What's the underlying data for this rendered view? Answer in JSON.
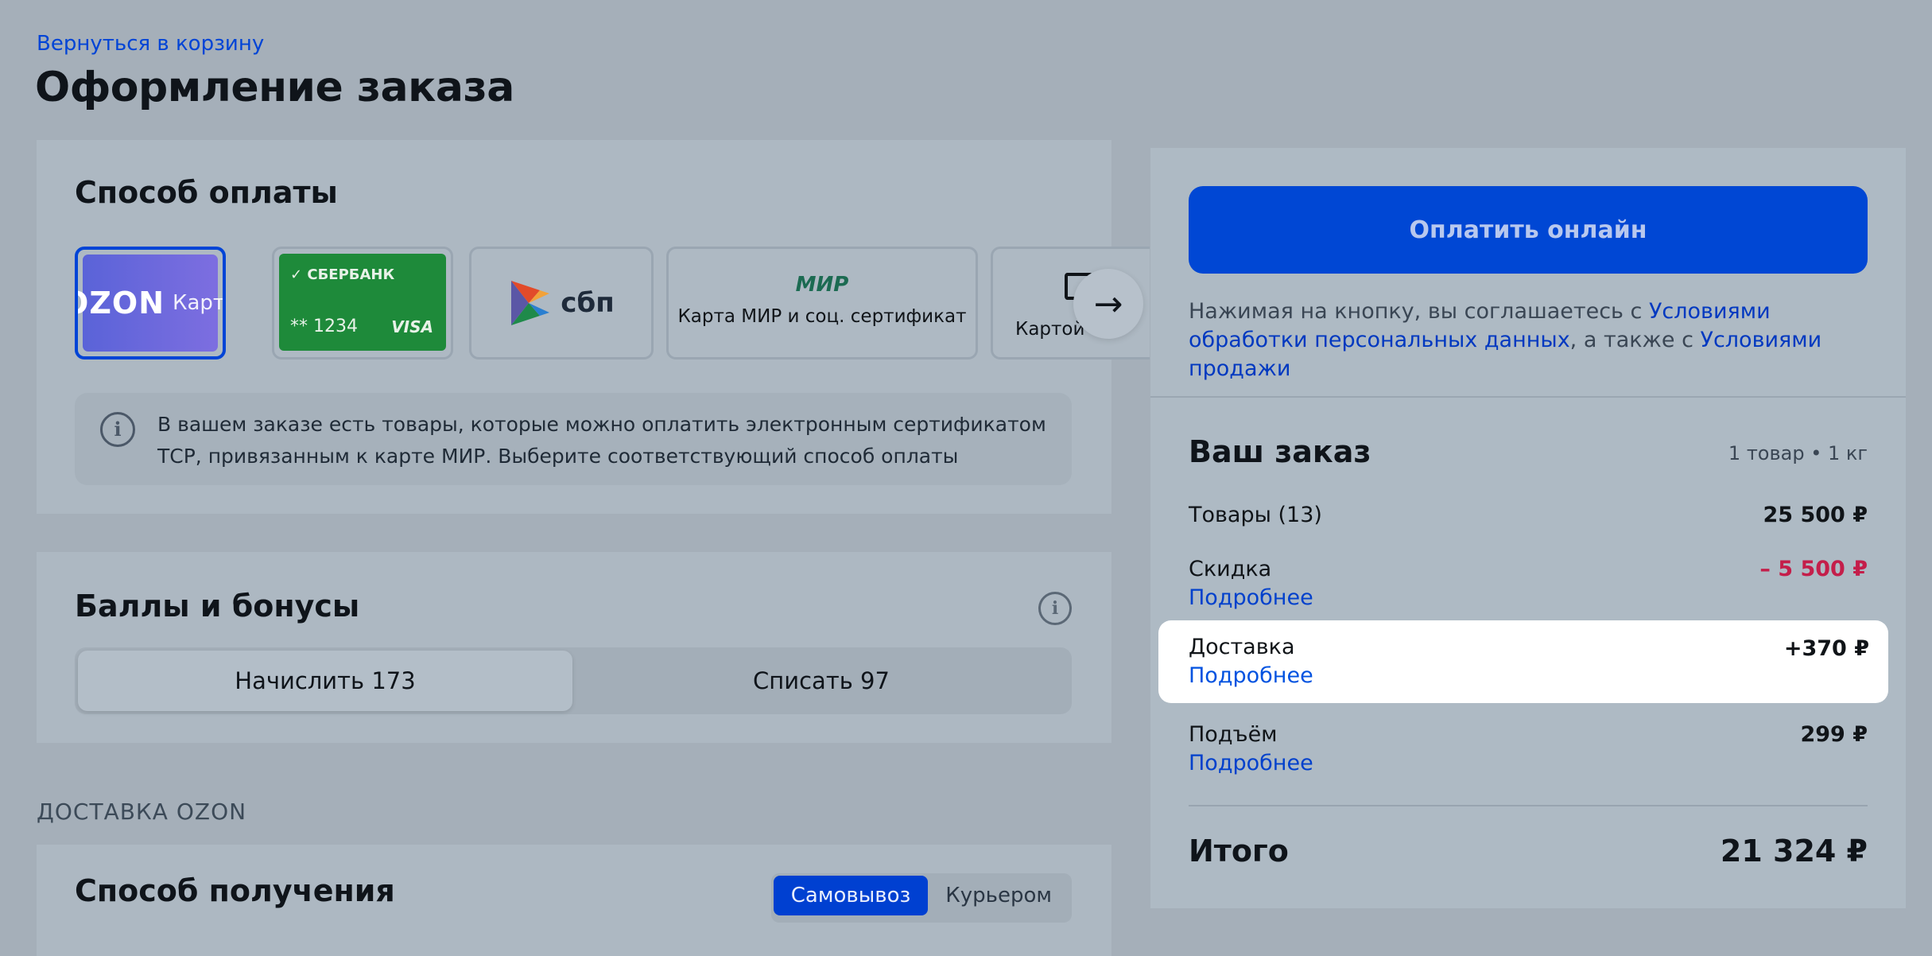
{
  "header": {
    "back_link": "Вернуться в корзину",
    "title": "Оформление заказа"
  },
  "payment": {
    "title": "Способ оплаты",
    "cards": {
      "ozon": {
        "logo": "OZON",
        "sub": "Карта"
      },
      "sber": {
        "name": "СБЕРБАНК",
        "number": "** 1234",
        "network": "VISA"
      },
      "sbp": {
        "label": "сбп"
      },
      "mir": {
        "logo": "МИР",
        "label": "Карта МИР и соц. сертификат"
      },
      "other": {
        "label": "Картой о"
      }
    },
    "next_icon": "arrow-right-icon",
    "info": "В вашем заказе есть товары, которые можно оплатить электронным сертификатом ТСР, привязанным к карте МИР.  Выберите соответствующий способ оплаты",
    "colors": {
      "selected_border": "#0044d6",
      "ozon_card": "#5a63d8",
      "sber_card": "#1e8a3a"
    }
  },
  "bonuses": {
    "title": "Баллы и бонусы",
    "options": [
      "Начислить 173",
      "Списать 97"
    ],
    "active_index": 0
  },
  "delivery": {
    "caption": "ДОСТАВКА OZON",
    "title": "Способ получения",
    "modes": [
      "Самовывоз",
      "Курьером"
    ],
    "active_mode": "Самовывоз"
  },
  "summary": {
    "pay_button": "Оплатить онлайн",
    "terms": {
      "prefix": "Нажимая на кнопку, вы соглашаетесь с ",
      "link1": "Условиями обработки персональных данных",
      "middle": ", а также с ",
      "link2": "Условиями продажи"
    },
    "order_title": "Ваш заказ",
    "order_meta": "1 товар • 1 кг",
    "rows": {
      "goods": {
        "label": "Товары (13)",
        "value": "25 500 ₽"
      },
      "discount": {
        "label": "Скидка",
        "link": "Подробнее",
        "value": "– 5 500 ₽"
      },
      "shipping": {
        "label": "Доставка",
        "link": "Подробнее",
        "value": "+370 ₽"
      },
      "lifting": {
        "label": "Подъём",
        "link": "Подробнее",
        "value": "299 ₽"
      }
    },
    "total": {
      "label": "Итого",
      "value": "21 324 ₽"
    },
    "colors": {
      "pay_button": "#0047d4",
      "discount": "#c41e4a",
      "link": "#0040cc"
    }
  }
}
